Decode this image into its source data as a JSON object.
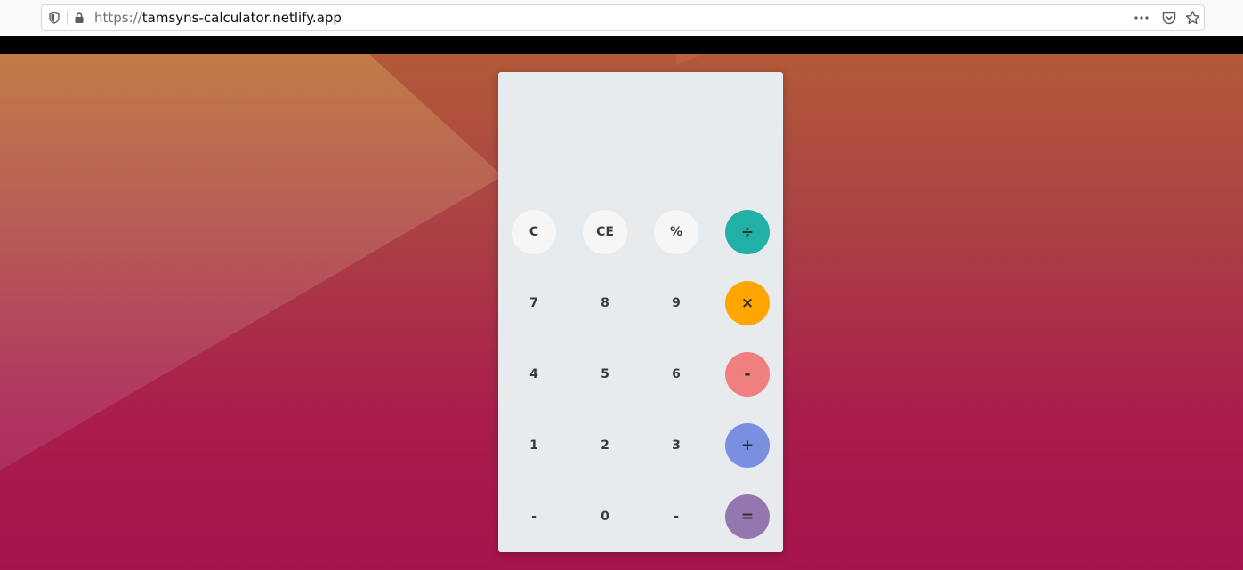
{
  "browser": {
    "url_scheme": "https://",
    "url_host": "tamsyns-calculator.netlify.app",
    "icons": [
      "shield-icon",
      "lock-icon",
      "more-dots-icon",
      "pocket-icon",
      "star-icon"
    ]
  },
  "calculator": {
    "display_value": "",
    "keys": {
      "clear": "C",
      "clear_entry": "CE",
      "percent": "%",
      "divide": "÷",
      "seven": "7",
      "eight": "8",
      "nine": "9",
      "multiply": "×",
      "four": "4",
      "five": "5",
      "six": "6",
      "subtract": "-",
      "one": "1",
      "two": "2",
      "three": "3",
      "add": "+",
      "negate": "-",
      "zero": "0",
      "decimal": "-",
      "equals": "="
    },
    "colors": {
      "divide": "#20b0a6",
      "multiply": "#ffa500",
      "subtract": "#f08080",
      "add": "#7b8fe0",
      "equals": "#9577b0",
      "panel": "#e8ebee"
    }
  }
}
